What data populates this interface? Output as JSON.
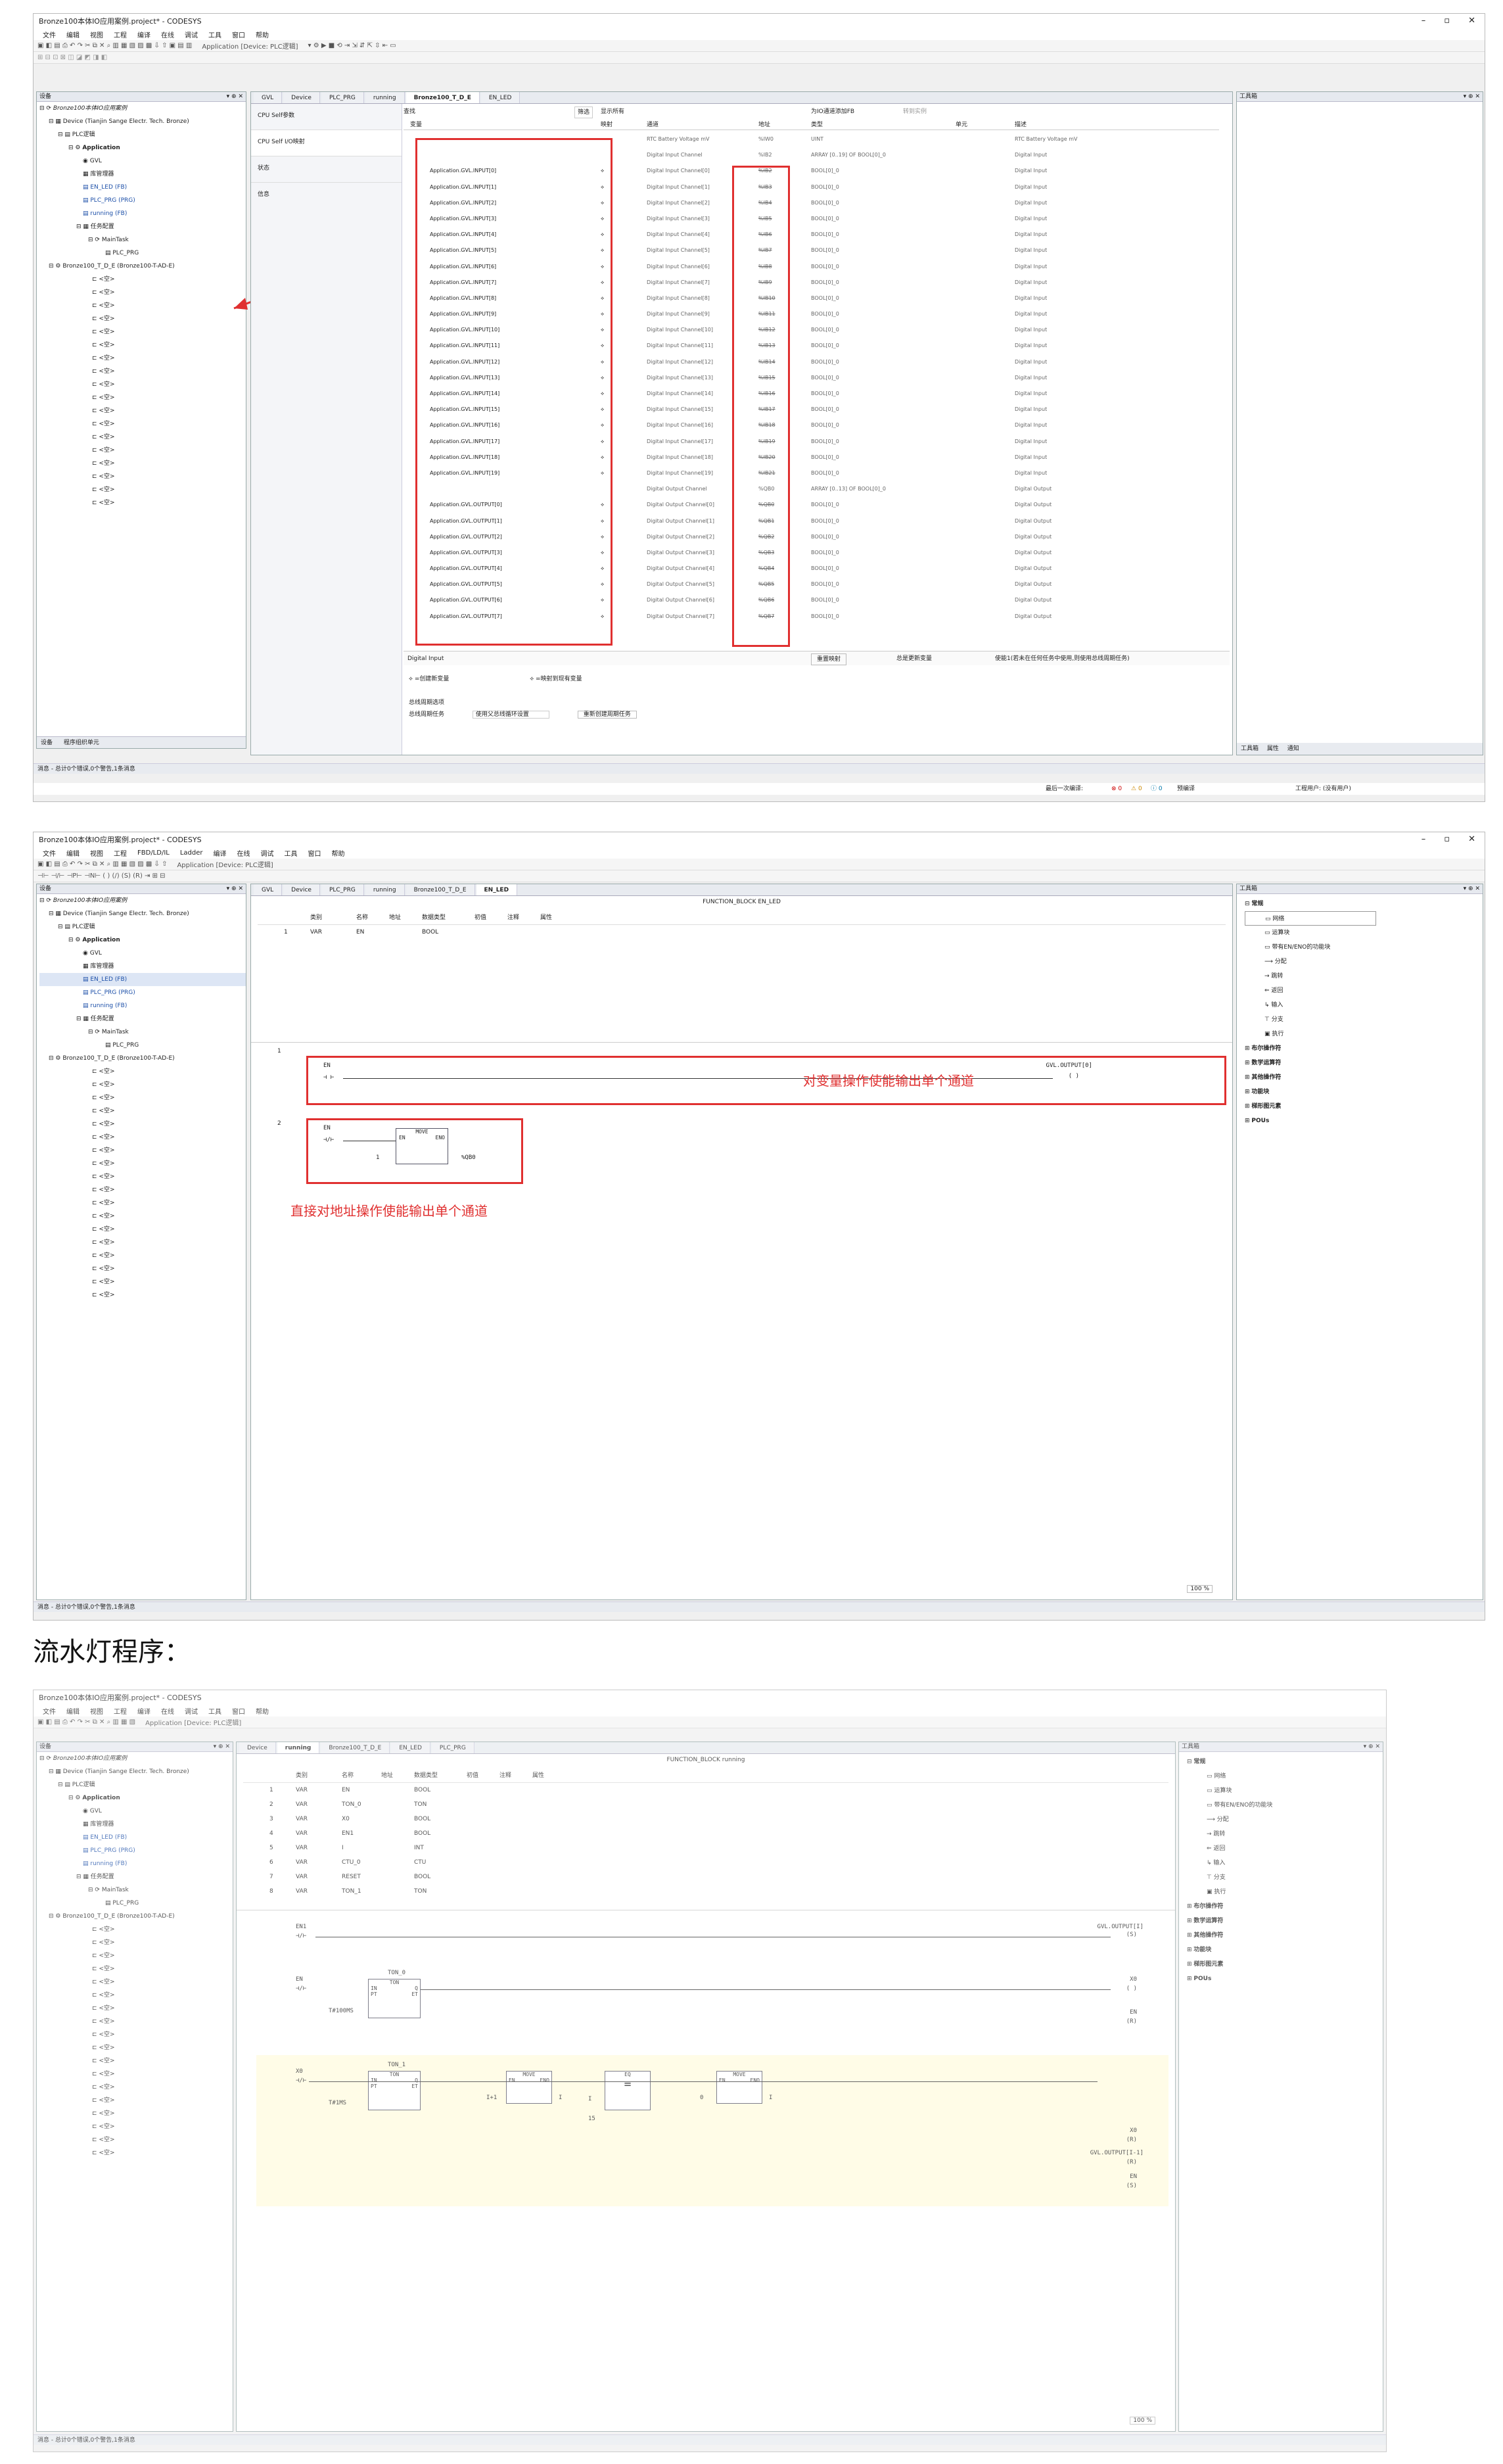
{
  "window": {
    "title": "Bronze100本体IO应用案例.project* - CODESYS",
    "menu": [
      "文件",
      "编辑",
      "视图",
      "工程",
      "编译",
      "在线",
      "调试",
      "工具",
      "窗口",
      "帮助"
    ],
    "menu2": [
      "文件",
      "编辑",
      "视图",
      "工程",
      "FBD/LD/IL",
      "Ladder",
      "编译",
      "在线",
      "调试",
      "工具",
      "窗口",
      "帮助"
    ],
    "active_app": "Application [Device: PLC逻辑]"
  },
  "device_panel": {
    "title": "设备",
    "root": "Bronze100本体IO应用案例",
    "device": "Device (Tianjin Sange Electr. Tech. Bronze)",
    "plc": "PLC逻辑",
    "application": "Application",
    "items": [
      "GVL",
      "库管理器",
      "EN_LED (FB)",
      "PLC_PRG (PRG)",
      "running (FB)",
      "任务配置",
      "MainTask",
      "PLC_PRG"
    ],
    "module": "Bronze100_T_D_E (Bronze100-T-AD-E)",
    "empty_slot": "<空>",
    "bottom_tabs": [
      "设备",
      "程序组织单元"
    ]
  },
  "screen1": {
    "tabs": [
      "GVL",
      "Device",
      "PLC_PRG",
      "running",
      "Bronze100_T_D_E",
      "EN_LED"
    ],
    "active_tab": "Bronze100_T_D_E",
    "side_nav": [
      "CPU Self参数",
      "CPU Self I/O映射",
      "状态",
      "信息"
    ],
    "search_label": "查找",
    "filter_label": "筛选",
    "show_all": "显示所有",
    "add_fb": "为IO通道添加FB",
    "goto_instance": "转到实例",
    "columns": [
      "变量",
      "映射",
      "通道",
      "地址",
      "类型",
      "单元",
      "描述"
    ],
    "rows": [
      {
        "var": "",
        "channel": "RTC Battery Voltage mV",
        "addr": "%IW0",
        "type": "UINT",
        "desc": "RTC Battery Voltage mV"
      },
      {
        "var": "",
        "channel": "Digital Input Channel",
        "addr": "%IB2",
        "type": "ARRAY [0..19] OF BOOL[0]_0",
        "desc": "Digital Input"
      },
      {
        "var": "Application.GVL.INPUT[0]",
        "channel": "Digital Input Channel[0]",
        "addr": "%IB2",
        "type": "BOOL[0]_0",
        "desc": "Digital Input"
      },
      {
        "var": "Application.GVL.INPUT[1]",
        "channel": "Digital Input Channel[1]",
        "addr": "%IB3",
        "type": "BOOL[0]_0",
        "desc": "Digital Input"
      },
      {
        "var": "Application.GVL.INPUT[2]",
        "channel": "Digital Input Channel[2]",
        "addr": "%IB4",
        "type": "BOOL[0]_0",
        "desc": "Digital Input"
      },
      {
        "var": "Application.GVL.INPUT[3]",
        "channel": "Digital Input Channel[3]",
        "addr": "%IB5",
        "type": "BOOL[0]_0",
        "desc": "Digital Input"
      },
      {
        "var": "Application.GVL.INPUT[4]",
        "channel": "Digital Input Channel[4]",
        "addr": "%IB6",
        "type": "BOOL[0]_0",
        "desc": "Digital Input"
      },
      {
        "var": "Application.GVL.INPUT[5]",
        "channel": "Digital Input Channel[5]",
        "addr": "%IB7",
        "type": "BOOL[0]_0",
        "desc": "Digital Input"
      },
      {
        "var": "Application.GVL.INPUT[6]",
        "channel": "Digital Input Channel[6]",
        "addr": "%IB8",
        "type": "BOOL[0]_0",
        "desc": "Digital Input"
      },
      {
        "var": "Application.GVL.INPUT[7]",
        "channel": "Digital Input Channel[7]",
        "addr": "%IB9",
        "type": "BOOL[0]_0",
        "desc": "Digital Input"
      },
      {
        "var": "Application.GVL.INPUT[8]",
        "channel": "Digital Input Channel[8]",
        "addr": "%IB10",
        "type": "BOOL[0]_0",
        "desc": "Digital Input"
      },
      {
        "var": "Application.GVL.INPUT[9]",
        "channel": "Digital Input Channel[9]",
        "addr": "%IB11",
        "type": "BOOL[0]_0",
        "desc": "Digital Input"
      },
      {
        "var": "Application.GVL.INPUT[10]",
        "channel": "Digital Input Channel[10]",
        "addr": "%IB12",
        "type": "BOOL[0]_0",
        "desc": "Digital Input"
      },
      {
        "var": "Application.GVL.INPUT[11]",
        "channel": "Digital Input Channel[11]",
        "addr": "%IB13",
        "type": "BOOL[0]_0",
        "desc": "Digital Input"
      },
      {
        "var": "Application.GVL.INPUT[12]",
        "channel": "Digital Input Channel[12]",
        "addr": "%IB14",
        "type": "BOOL[0]_0",
        "desc": "Digital Input"
      },
      {
        "var": "Application.GVL.INPUT[13]",
        "channel": "Digital Input Channel[13]",
        "addr": "%IB15",
        "type": "BOOL[0]_0",
        "desc": "Digital Input"
      },
      {
        "var": "Application.GVL.INPUT[14]",
        "channel": "Digital Input Channel[14]",
        "addr": "%IB16",
        "type": "BOOL[0]_0",
        "desc": "Digital Input"
      },
      {
        "var": "Application.GVL.INPUT[15]",
        "channel": "Digital Input Channel[15]",
        "addr": "%IB17",
        "type": "BOOL[0]_0",
        "desc": "Digital Input"
      },
      {
        "var": "Application.GVL.INPUT[16]",
        "channel": "Digital Input Channel[16]",
        "addr": "%IB18",
        "type": "BOOL[0]_0",
        "desc": "Digital Input"
      },
      {
        "var": "Application.GVL.INPUT[17]",
        "channel": "Digital Input Channel[17]",
        "addr": "%IB19",
        "type": "BOOL[0]_0",
        "desc": "Digital Input"
      },
      {
        "var": "Application.GVL.INPUT[18]",
        "channel": "Digital Input Channel[18]",
        "addr": "%IB20",
        "type": "BOOL[0]_0",
        "desc": "Digital Input"
      },
      {
        "var": "Application.GVL.INPUT[19]",
        "channel": "Digital Input Channel[19]",
        "addr": "%IB21",
        "type": "BOOL[0]_0",
        "desc": "Digital Input"
      },
      {
        "var": "",
        "channel": "Digital Output Channel",
        "addr": "%QB0",
        "type": "ARRAY [0..13] OF BOOL[0]_0",
        "desc": "Digital Output"
      },
      {
        "var": "Application.GVL.OUTPUT[0]",
        "channel": "Digital Output Channel[0]",
        "addr": "%QB0",
        "type": "BOOL[0]_0",
        "desc": "Digital Output"
      },
      {
        "var": "Application.GVL.OUTPUT[1]",
        "channel": "Digital Output Channel[1]",
        "addr": "%QB1",
        "type": "BOOL[0]_0",
        "desc": "Digital Output"
      },
      {
        "var": "Application.GVL.OUTPUT[2]",
        "channel": "Digital Output Channel[2]",
        "addr": "%QB2",
        "type": "BOOL[0]_0",
        "desc": "Digital Output"
      },
      {
        "var": "Application.GVL.OUTPUT[3]",
        "channel": "Digital Output Channel[3]",
        "addr": "%QB3",
        "type": "BOOL[0]_0",
        "desc": "Digital Output"
      },
      {
        "var": "Application.GVL.OUTPUT[4]",
        "channel": "Digital Output Channel[4]",
        "addr": "%QB4",
        "type": "BOOL[0]_0",
        "desc": "Digital Output"
      },
      {
        "var": "Application.GVL.OUTPUT[5]",
        "channel": "Digital Output Channel[5]",
        "addr": "%QB5",
        "type": "BOOL[0]_0",
        "desc": "Digital Output"
      },
      {
        "var": "Application.GVL.OUTPUT[6]",
        "channel": "Digital Output Channel[6]",
        "addr": "%QB6",
        "type": "BOOL[0]_0",
        "desc": "Digital Output"
      },
      {
        "var": "Application.GVL.OUTPUT[7]",
        "channel": "Digital Output Channel[7]",
        "addr": "%QB7",
        "type": "BOOL[0]_0",
        "desc": "Digital Output"
      }
    ],
    "footer_label": "Digital Input",
    "reset_mapping": "重置映射",
    "always_update": "总是更新变量",
    "footer_right": "使能1(若未在任何任务中使用,则使用总线周期任务)",
    "legend_new": "=创建新变量",
    "legend_existing": "=映射到现有变量",
    "bus_cycle_options": "总线周期选项",
    "bus_cycle_task": "总线周期任务",
    "bus_cycle_value": "使用父总线循环设置",
    "recreate_task": "重新创建周期任务"
  },
  "toolbox": {
    "title": "工具箱",
    "groups": [
      "常规",
      "布尔操作符",
      "数学运算符",
      "其他操作符",
      "功能块",
      "梯形图元素",
      "POUs"
    ],
    "items": [
      "网络",
      "运算块",
      "带有EN/ENO的功能块",
      "分配",
      "跳转",
      "返回",
      "输入",
      "分支",
      "执行"
    ],
    "bottom_tabs": [
      "工具箱",
      "属性",
      "通知"
    ]
  },
  "status": {
    "messages": "消息 - 总计0个错误,0个警告,1条消息",
    "last_compile": "最后一次编译:",
    "counts": [
      "0",
      "0",
      "0"
    ],
    "precompile": "预编译",
    "project_user": "工程用户: (没有用户)",
    "lang": "英"
  },
  "screen2": {
    "tabs": [
      "GVL",
      "Device",
      "PLC_PRG",
      "running",
      "Bronze100_T_D_E",
      "EN_LED"
    ],
    "active_tab": "EN_LED",
    "fb_header": "FUNCTION_BLOCK EN_LED",
    "decl_columns": [
      "类别",
      "名称",
      "地址",
      "数据类型",
      "初值",
      "注释",
      "属性"
    ],
    "decl_rows": [
      {
        "n": "1",
        "cat": "VAR",
        "name": "EN",
        "type": "BOOL"
      }
    ],
    "rung1": {
      "contact": "EN",
      "coil": "GVL.OUTPUT[0]",
      "num": "1"
    },
    "rung2": {
      "contact": "EN",
      "block": "MOVE",
      "en": "EN",
      "eno": "ENO",
      "in": "1",
      "out": "%QB0",
      "num": "2"
    },
    "annot1": "对变量操作使能输出单个通道",
    "annot2": "直接对地址操作使能输出单个通道",
    "zoom": "100 %"
  },
  "heading": "流水灯程序：",
  "screen3": {
    "tabs": [
      "Device",
      "running",
      "Bronze100_T_D_E",
      "EN_LED",
      "PLC_PRG"
    ],
    "active_tab": "running",
    "fb_header": "FUNCTION_BLOCK running",
    "decl_columns": [
      "类别",
      "名称",
      "地址",
      "数据类型",
      "初值",
      "注释",
      "属性"
    ],
    "decl_rows": [
      {
        "n": "1",
        "cat": "VAR",
        "name": "EN",
        "type": "BOOL"
      },
      {
        "n": "2",
        "cat": "VAR",
        "name": "TON_0",
        "type": "TON"
      },
      {
        "n": "3",
        "cat": "VAR",
        "name": "X0",
        "type": "BOOL"
      },
      {
        "n": "4",
        "cat": "VAR",
        "name": "EN1",
        "type": "BOOL"
      },
      {
        "n": "5",
        "cat": "VAR",
        "name": "I",
        "type": "INT"
      },
      {
        "n": "6",
        "cat": "VAR",
        "name": "CTU_0",
        "type": "CTU"
      },
      {
        "n": "7",
        "cat": "VAR",
        "name": "RESET",
        "type": "BOOL"
      },
      {
        "n": "8",
        "cat": "VAR",
        "name": "TON_1",
        "type": "TON"
      }
    ],
    "r1": {
      "contact": "EN1",
      "coil": "GVL.OUTPUT[I]"
    },
    "r2": {
      "contact": "EN",
      "inst": "TON_0",
      "block": "TON",
      "pt": "T#100MS",
      "coil1": "X0",
      "coil2": "EN"
    },
    "r3": {
      "contact": "X0",
      "inst": "TON_1",
      "block": "TON",
      "pt": "T#1MS",
      "move1_in": "I+1",
      "move1_out": "I",
      "eq_block": "EQ",
      "eq_in1": "I",
      "eq_in2": "15",
      "move2_in": "0",
      "move2_out": "I",
      "coil1": "X0",
      "coil2": "GVL.OUTPUT[I-1]",
      "coil3": "EN",
      "move": "MOVE",
      "in_lbl": "IN",
      "pt_lbl": "PT",
      "q_lbl": "Q",
      "et_lbl": "ET",
      "en_lbl": "EN",
      "eno_lbl": "ENO"
    },
    "zoom": "100 %"
  }
}
